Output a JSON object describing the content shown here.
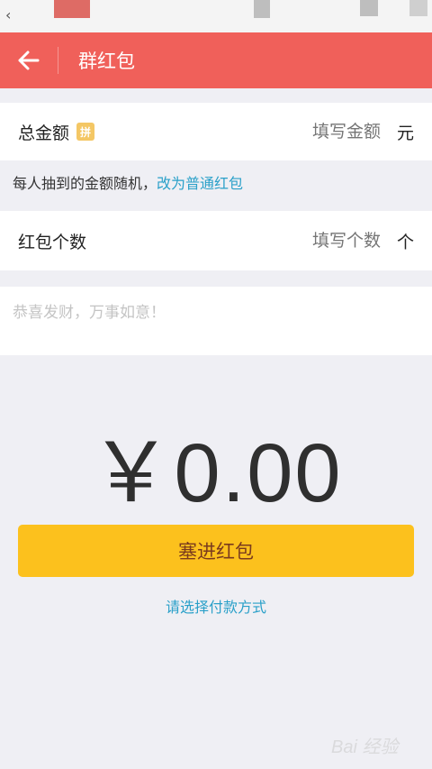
{
  "header": {
    "title": "群红包"
  },
  "amount_row": {
    "label": "总金额",
    "badge": "拼",
    "placeholder": "填写金额",
    "unit": "元"
  },
  "hint": {
    "text": "每人抽到的金额随机，",
    "link": "改为普通红包"
  },
  "count_row": {
    "label": "红包个数",
    "placeholder": "填写个数",
    "unit": "个"
  },
  "message": {
    "placeholder": "恭喜发财，万事如意！"
  },
  "total": {
    "display": "￥0.00"
  },
  "submit": {
    "label": "塞进红包"
  },
  "pay_method": {
    "label": "请选择付款方式"
  },
  "watermark": {
    "text": "Bai 经验"
  },
  "colors": {
    "header_bg": "#f0605a",
    "submit_bg": "#fcc11d",
    "link": "#2aa0c9",
    "page_bg": "#efeff4"
  },
  "icons": {
    "back": "arrow-left-icon",
    "status_back": "chevron-left-icon"
  }
}
